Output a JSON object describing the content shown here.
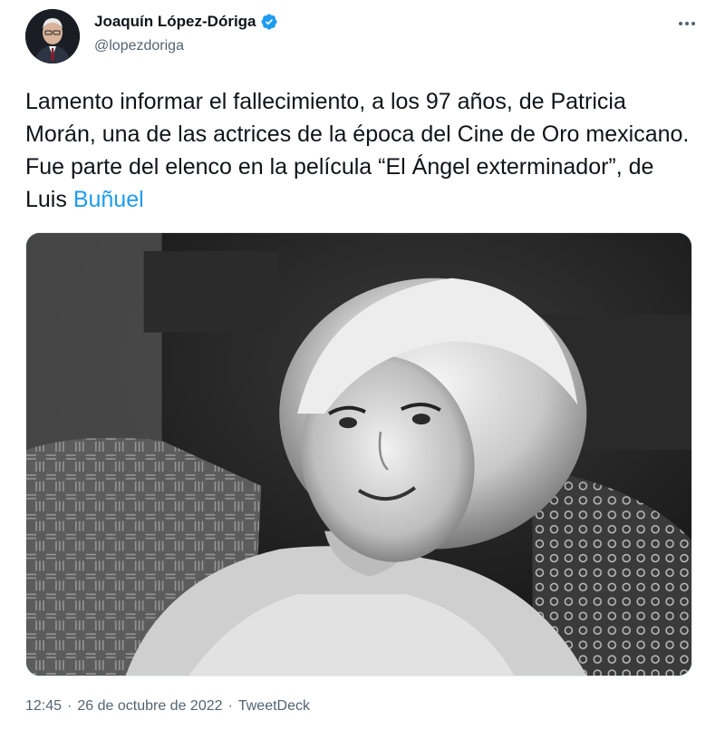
{
  "author": {
    "display_name": "Joaquín López-Dóriga",
    "handle": "@lopezdoriga",
    "verified": true
  },
  "tweet": {
    "text_main": "Lamento informar el fallecimiento, a los 97 años, de Patricia Morán, una de las actrices de la época del Cine de Oro mexicano. Fue parte del elenco en la película “El Ángel exterminador”, de Luis ",
    "text_link": "Buñuel"
  },
  "meta": {
    "time": "12:45",
    "separator_1": "·",
    "date": "26 de octubre de 2022",
    "separator_2": "·",
    "source": "TweetDeck"
  },
  "colors": {
    "link": "#1d9bf0",
    "verified_badge": "#1d9bf0",
    "secondary_text": "#536471"
  }
}
